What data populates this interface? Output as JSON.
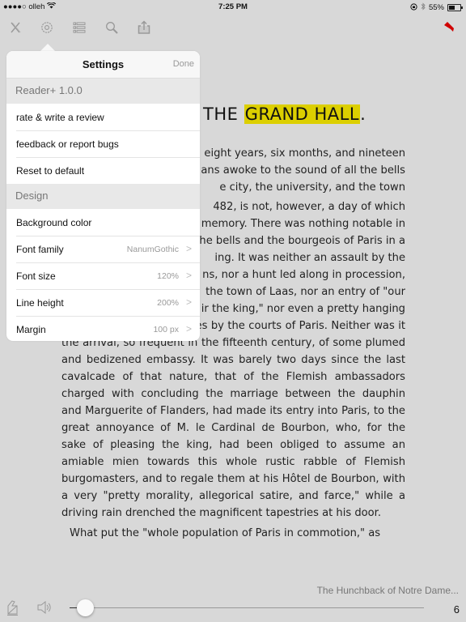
{
  "status_bar": {
    "carrier": "●●●●○ olleh",
    "time": "7:25 PM",
    "battery": "55%",
    "battery_level": 0.55
  },
  "toolbar": {
    "icons": [
      "close-icon",
      "gear-icon",
      "list-icon",
      "search-icon",
      "share-icon",
      "bookmark-icon"
    ],
    "accent_color": "#d00000"
  },
  "settings": {
    "title": "Settings",
    "done_label": "Done",
    "app_section": "Reader+ 1.0.0",
    "app_rows": [
      {
        "label": "rate & write a review"
      },
      {
        "label": "feedback or report bugs"
      },
      {
        "label": "Reset to default"
      }
    ],
    "design_section": "Design",
    "design_rows": [
      {
        "label": "Background color",
        "value": ""
      },
      {
        "label": "Font family",
        "value": "NanumGothic"
      },
      {
        "label": "Font size",
        "value": "120%"
      },
      {
        "label": "Line height",
        "value": "200%"
      },
      {
        "label": "Margin",
        "value": "100 px"
      }
    ]
  },
  "content": {
    "chapter_prefix": "THE ",
    "chapter_highlight": "GRAND HALL",
    "chapter_suffix": ".",
    "highlight_color": "#dccf00",
    "lines": [
      "eight years, six months, and nineteen",
      "ans awoke to the sound of all the bells",
      "e city, the university, and the town",
      "482, is not, however, a day of which",
      "memory. There was nothing notable in",
      "he bells and the bourgeois of Paris in a",
      "ing. It was neither an assault by the",
      "ns, nor a hunt led along in procession,",
      "the town of Laas, nor an entry of \"our",
      "ir the king,\" nor even a pretty hanging",
      "of male and female thieves by the courts of Paris. Neither was it",
      "the arrival, so frequent in the fifteenth century, of some plumed",
      "and bedizened embassy. It was barely two days since the last",
      "cavalcade of that nature, that of the Flemish ambassadors",
      "charged with concluding the marriage between the dauphin",
      "and Marguerite of Flanders, had made its entry into Paris, to the",
      "great annoyance of M. le Cardinal de Bourbon, who, for the",
      "sake of pleasing the king, had been obliged to assume an",
      "amiable mien towards this whole rustic rabble of Flemish",
      "burgomasters, and to regale them at his Hôtel de Bourbon, with",
      "a very \"pretty morality, allegorical satire, and farce,\" while a",
      "driving rain drenched the magnificent tapestries at his door.",
      "What put the \"whole population of Paris in commotion,\" as"
    ]
  },
  "footer": {
    "book_title": "The Hunchback of Notre Dame...",
    "page_number": "6",
    "progress": 0.02
  }
}
